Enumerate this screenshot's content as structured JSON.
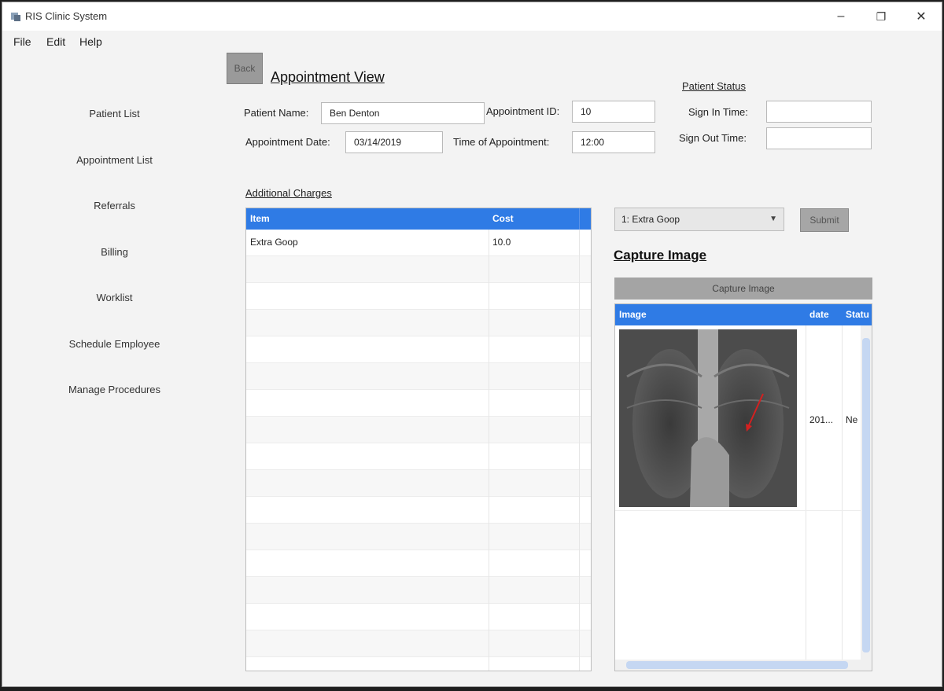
{
  "window": {
    "title": "RIS Clinic System",
    "controls": {
      "minimize": "–",
      "maximize": "❐",
      "close": "✕"
    }
  },
  "menu": [
    "File",
    "Edit",
    "Help"
  ],
  "nav": [
    "Patient List",
    "Appointment List",
    "Referrals",
    "Billing",
    "Worklist",
    "Schedule Employee",
    "Manage Procedures"
  ],
  "back_label": "Back",
  "page_title": "Appointment View",
  "form": {
    "patient_name_label": "Patient Name:",
    "patient_name": "Ben Denton",
    "appointment_id_label": "Appointment ID:",
    "appointment_id": "10",
    "appointment_date_label": "Appointment Date:",
    "appointment_date": "03/14/2019",
    "time_label": "Time of Appointment:",
    "time": "12:00"
  },
  "patient_status": {
    "heading": "Patient Status",
    "sign_in_label": "Sign In Time:",
    "sign_in": "",
    "sign_out_label": "Sign Out Time:",
    "sign_out": ""
  },
  "charges": {
    "heading": "Additional Charges",
    "columns": [
      "Item",
      "Cost"
    ],
    "rows": [
      {
        "item": "Extra Goop",
        "cost": "10.0"
      }
    ]
  },
  "charge_select": {
    "value": "1: Extra Goop",
    "arrow": "▼"
  },
  "submit_label": "Submit",
  "capture": {
    "heading": "Capture Image",
    "button": "Capture Image",
    "columns": [
      "Image",
      "date",
      "Statu"
    ],
    "rows": [
      {
        "date": "201...",
        "status": "Ne"
      }
    ]
  },
  "colors": {
    "header_blue": "#2f7be5",
    "button_gray": "#a4a4a4",
    "arrow_red": "#d42020"
  }
}
